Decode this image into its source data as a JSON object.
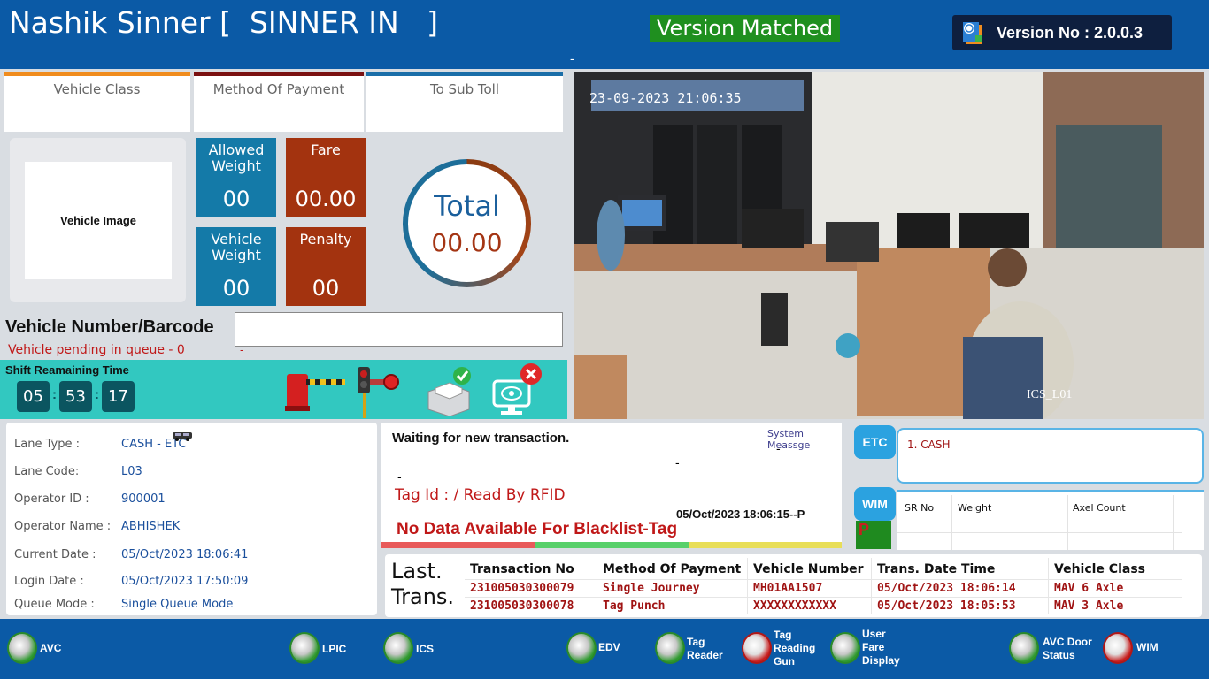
{
  "header": {
    "title": "Nashik Sinner [  SINNER IN   ]",
    "version_status": "Version Matched",
    "version_label": "Version No : 2.0.0.3",
    "dash": "-"
  },
  "top_boxes": {
    "vehicle_class": "Vehicle Class",
    "method_of_payment": "Method Of Payment",
    "to_sub_toll": "To Sub Toll"
  },
  "vehicle_image_label": "Vehicle Image",
  "tiles": {
    "allowed_weight_label": "Allowed Weight",
    "allowed_weight_value": "00",
    "fare_label": "Fare",
    "fare_value": "00.00",
    "vehicle_weight_label": "Vehicle Weight",
    "vehicle_weight_value": "00",
    "penalty_label": "Penalty",
    "penalty_value": "00"
  },
  "total": {
    "label": "Total",
    "value": "00.00"
  },
  "vehicle_number": {
    "label": "Vehicle Number/Barcode",
    "value": "",
    "queue_text": "Vehicle pending in queue - 0",
    "red_dash": "-"
  },
  "shift": {
    "label": "Shift Reamaining Time",
    "hours": "05",
    "minutes": "53",
    "seconds": "17"
  },
  "camera": {
    "timestamp": "23-09-2023 21:06:35",
    "label": "ICS_L01"
  },
  "lane_info": {
    "rows": [
      {
        "key": "Lane Type :",
        "value": "CASH - ETC"
      },
      {
        "key": "Lane Code:",
        "value": "L03"
      },
      {
        "key": "Operator ID :",
        "value": "900001"
      },
      {
        "key": "Operator Name :",
        "value": "ABHISHEK"
      },
      {
        "key": "Current Date :",
        "value": "05/Oct/2023 18:06:41"
      },
      {
        "key": "Login Date :",
        "value": "05/Oct/2023 17:50:09"
      },
      {
        "key": "Queue Mode :",
        "value": "Single Queue Mode"
      }
    ]
  },
  "system_message": {
    "label": "System Meassge",
    "waiting": "Waiting for new transaction.",
    "dash": "-",
    "tag_id": "Tag Id : / Read By RFID",
    "datetime": "05/Oct/2023 18:06:15--P",
    "blacklist": "No Data Available For Blacklist-Tag",
    "bar_colors": [
      "#e85a5a",
      "#58d06a",
      "#e8de58"
    ]
  },
  "etc": {
    "badge": "ETC",
    "items": [
      "1. CASH"
    ]
  },
  "wim": {
    "badge": "WIM",
    "columns": [
      "SR No",
      "Weight",
      "Axel Count"
    ],
    "status": "P"
  },
  "last_transactions": {
    "label_line1": "Last.",
    "label_line2": "Trans.",
    "columns": [
      "Transaction No",
      "Method Of Payment",
      "Vehicle Number",
      "Trans. Date Time",
      "Vehicle Class"
    ],
    "rows": [
      [
        "231005030300079",
        "Single Journey",
        "MH01AA1507",
        "05/Oct/2023 18:06:14",
        "MAV 6 Axle"
      ],
      [
        "231005030300078",
        "Tag Punch",
        "XXXXXXXXXXXX",
        "05/Oct/2023 18:05:53",
        "MAV 3 Axle"
      ]
    ]
  },
  "footer": {
    "avc": "AVC",
    "lpic": "LPIC",
    "ics": "ICS",
    "edv": "EDV",
    "tag_reader_1": "Tag",
    "tag_reader_2": "Reader",
    "tag_gun_1": "Tag",
    "tag_gun_2": "Reading",
    "tag_gun_3": "Gun",
    "ufd_1": "User",
    "ufd_2": "Fare",
    "ufd_3": "Display",
    "avc_door_1": "AVC Door",
    "avc_door_2": "Status",
    "wim": "WIM"
  }
}
